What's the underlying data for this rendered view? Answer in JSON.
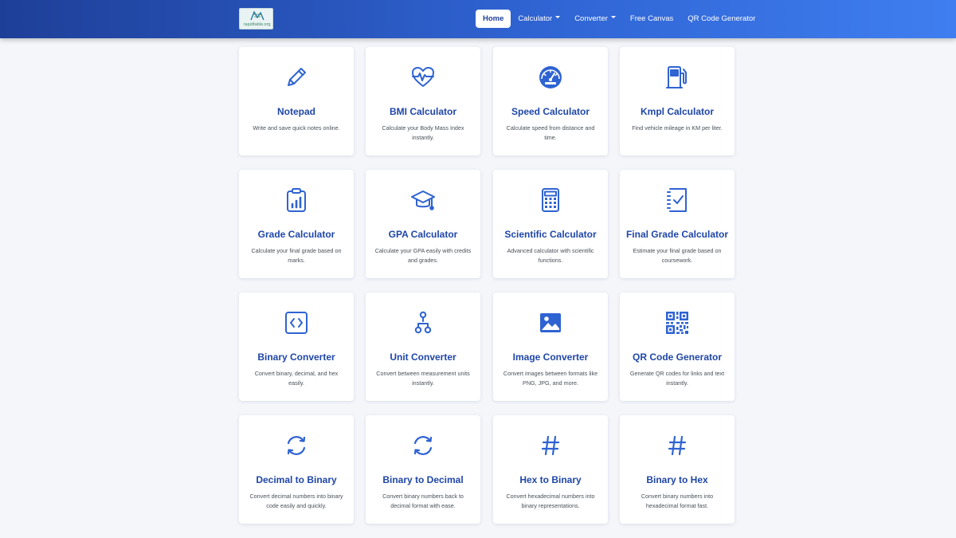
{
  "brand": {
    "logo_text": "rapidtable.org"
  },
  "nav": {
    "home": "Home",
    "calculator": "Calculator",
    "converter": "Converter",
    "free_canvas": "Free Canvas",
    "qr_code_generator": "QR Code Generator"
  },
  "colors": {
    "accent": "#1f46a8",
    "icon": "#2f63d2",
    "nav_start": "#1e3f98",
    "nav_end": "#3f7ef0"
  },
  "cards": [
    {
      "title": "Notepad",
      "desc": "Write and save quick notes online.",
      "icon": "pencil-icon"
    },
    {
      "title": "BMI Calculator",
      "desc": "Calculate your Body Mass Index instantly.",
      "icon": "heartbeat-icon"
    },
    {
      "title": "Speed Calculator",
      "desc": "Calculate speed from distance and time.",
      "icon": "speedometer-icon"
    },
    {
      "title": "Kmpl Calculator",
      "desc": "Find vehicle mileage in KM per liter.",
      "icon": "fuel-pump-icon"
    },
    {
      "title": "Grade Calculator",
      "desc": "Calculate your final grade based on marks.",
      "icon": "clipboard-chart-icon"
    },
    {
      "title": "GPA Calculator",
      "desc": "Calculate your GPA easily with credits and grades.",
      "icon": "graduation-cap-icon"
    },
    {
      "title": "Scientific Calculator",
      "desc": "Advanced calculator with scientific functions.",
      "icon": "calculator-icon"
    },
    {
      "title": "Final Grade Calculator",
      "desc": "Estimate your final grade based on coursework.",
      "icon": "checklist-icon"
    },
    {
      "title": "Binary Converter",
      "desc": "Convert binary, decimal, and hex easily.",
      "icon": "code-icon"
    },
    {
      "title": "Unit Converter",
      "desc": "Convert between measurement units instantly.",
      "icon": "hierarchy-icon"
    },
    {
      "title": "Image Converter",
      "desc": "Convert images between formats like PNG, JPG, and more.",
      "icon": "image-icon"
    },
    {
      "title": "QR Code Generator",
      "desc": "Generate QR codes for links and text instantly.",
      "icon": "qr-code-icon"
    },
    {
      "title": "Decimal to Binary",
      "desc": "Convert decimal numbers into binary code easily and quickly.",
      "icon": "refresh-icon"
    },
    {
      "title": "Binary to Decimal",
      "desc": "Convert binary numbers back to decimal format with ease.",
      "icon": "refresh-icon"
    },
    {
      "title": "Hex to Binary",
      "desc": "Convert hexadecimal numbers into binary representations.",
      "icon": "hash-icon"
    },
    {
      "title": "Binary to Hex",
      "desc": "Convert binary numbers into hexadecimal format fast.",
      "icon": "hash-icon"
    }
  ]
}
